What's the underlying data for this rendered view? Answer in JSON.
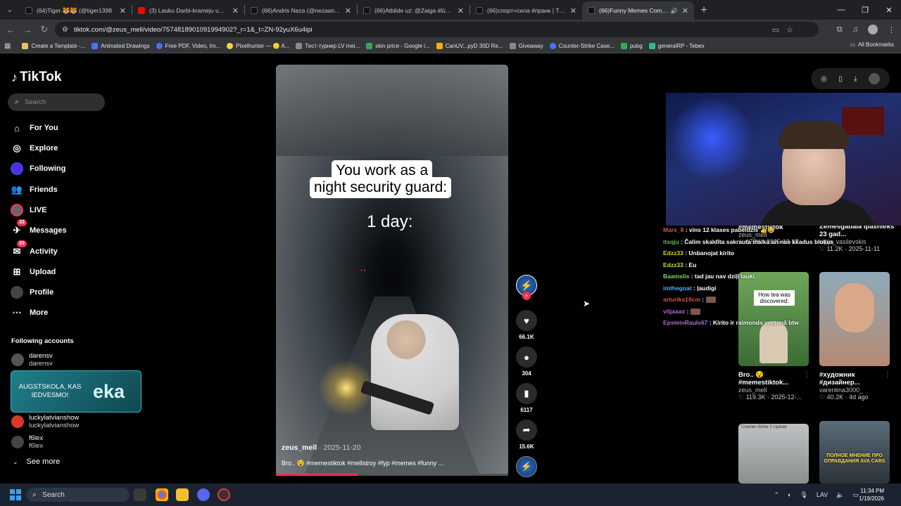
{
  "tabs": [
    {
      "title": "(64)Tiger 🐯🐯 (@tiger1398",
      "color": "#111111",
      "active": false
    },
    {
      "title": "(3) Lauku Darbi-krameju un izk",
      "color": "#ff0000",
      "active": false
    },
    {
      "title": "(66)Andris Neza (@nezaandris",
      "color": "#111111",
      "active": false
    },
    {
      "title": "(66)Atbilde uz: @Zaiga #lūgšan",
      "color": "#111111",
      "active": false
    },
    {
      "title": "(66)спорт=сила #пранк | TikTo",
      "color": "#111111",
      "active": false
    },
    {
      "title": "(66)Funny Memes Compilat",
      "color": "#111111",
      "active": true
    }
  ],
  "url": "tiktok.com/@zeus_mell/video/7574818901091994902?_r=1&_t=ZN-92yuX6u4ipi",
  "bookmarks": [
    {
      "label": "Create a Template -...",
      "color": "#e6c36a"
    },
    {
      "label": "Animated Drawings",
      "color": "#4a73ff"
    },
    {
      "label": "Free PDF, Video, Im...",
      "color": "#4e6bff"
    },
    {
      "label": "Pixelhunter — 🟡 A...",
      "color": "#f5d442"
    },
    {
      "label": "Тест-турнир LV mei...",
      "color": "#8a8a8a"
    },
    {
      "label": "skin price - Google i...",
      "color": "#34a853"
    },
    {
      "label": "CanUV...pyD 30D Re...",
      "color": "#f4b400"
    },
    {
      "label": "Giveaway",
      "color": "#888888"
    },
    {
      "label": "Counter-Strike Case...",
      "color": "#4a73ff"
    },
    {
      "label": "pubg",
      "color": "#34a853"
    },
    {
      "label": "generalRP - Tebex",
      "color": "#2dbb8a"
    }
  ],
  "all_bookmarks": "All Bookmarks",
  "brand": "TikTok",
  "search_placeholder": "Search",
  "nav": [
    {
      "label": "For You",
      "icon": "home-icon",
      "badge": ""
    },
    {
      "label": "Explore",
      "icon": "compass-icon",
      "badge": ""
    },
    {
      "label": "Following",
      "icon": "following-avatar-icon",
      "badge": ""
    },
    {
      "label": "Friends",
      "icon": "friends-icon",
      "badge": ""
    },
    {
      "label": "LIVE",
      "icon": "live-icon",
      "badge": ""
    },
    {
      "label": "Messages",
      "icon": "messages-icon",
      "badge": "33"
    },
    {
      "label": "Activity",
      "icon": "activity-icon",
      "badge": "33"
    },
    {
      "label": "Upload",
      "icon": "upload-icon",
      "badge": ""
    },
    {
      "label": "Profile",
      "icon": "profile-avatar-icon",
      "badge": ""
    },
    {
      "label": "More",
      "icon": "more-icon",
      "badge": ""
    }
  ],
  "following_title": "Following accounts",
  "following_accounts": [
    {
      "name": "darensv",
      "user": "darensv",
      "color": "#555555"
    },
    {
      "name": "luckylatvianshow",
      "user": "luckylatvianshow",
      "color": "#d83a2a"
    },
    {
      "name": "f6lex",
      "user": "f6lex",
      "color": "#444444"
    }
  ],
  "see_more": "See more",
  "promo": {
    "left": "AUGSTSKOLA, KAS IEDVESMO!",
    "right": "eka"
  },
  "video": {
    "caption_line1": "You work as a",
    "caption_line2": "night security guard:",
    "caption_day": "1 day:",
    "author": "zeus_mell",
    "date": "· 2025-11-20",
    "description": "Bro.. 😵 #memestiktok #mellstroy #fyp #memes #funny ...",
    "progress": 0.35
  },
  "actions": {
    "likes": "66.1K",
    "comments": "304",
    "saves": "6117",
    "shares": "15.6K"
  },
  "chat": [
    {
      "user": "Marx_8",
      "color": "#d9534f",
      "text": ": vins 12 klases pabeidzis 👍😂"
    },
    {
      "user": "itsqju",
      "color": "#5cb85c",
      "text": ": Čalim skaldīta sakrauta malka un nes kkadus bluķus"
    },
    {
      "user": "Edzz33",
      "color": "#d6d62e",
      "text": ": Unbanojat kirito"
    },
    {
      "user": "Edzz33",
      "color": "#d6d62e",
      "text": ": Eu"
    },
    {
      "user": "Baamslis",
      "color": "#7bd86a",
      "text": ": tad jau nav dziļi lauki"
    },
    {
      "user": "imthegoat",
      "color": "#5aa9ff",
      "text": ": ļaudigi"
    },
    {
      "user": "arturiks19cm",
      "color": "#d9534f",
      "text": ":"
    },
    {
      "user": "vitjaaax",
      "color": "#b06ad8",
      "text": ":"
    },
    {
      "user": "EpsteinRauls67",
      "color": "#b06ad8",
      "text": ": Kirito ir raimonda vecumā btw"
    }
  ],
  "feed": [
    {
      "title": "#memestiktok",
      "user": "zeus_mell",
      "likes": "172K",
      "date": "2025-12-17"
    },
    {
      "title": "Zemesgabala īpašnieks 23 gad...",
      "user": "edijs_vasilevskis",
      "likes": "11.2K",
      "date": "2025-11-11"
    },
    {
      "title": "Bro.. 😵 #memestiktok...",
      "user": "zeus_mell",
      "likes": "119.3K",
      "date": "2025-12-...",
      "thumb_text": "How tea was discovered:"
    },
    {
      "title": "#художник #дизайнер...",
      "user": "varentina3000_",
      "likes": "40.2K",
      "date": "4d ago"
    },
    {
      "thumb_text": "Counter-Strike 2 Update"
    },
    {
      "thumb_text": "ПОЛНОЕ МНЕНИЕ ПРО ОПРАВДАНИЯ AVA CARS"
    }
  ],
  "taskbar": {
    "search": "Search",
    "lang": "LAV",
    "time": "11:34 PM",
    "date": "1/19/2026"
  }
}
